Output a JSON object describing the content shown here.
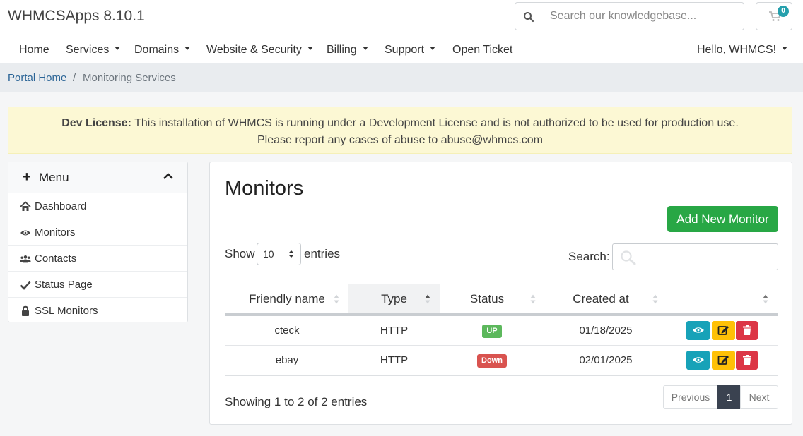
{
  "header": {
    "brand": "WHMCSApps 8.10.1",
    "search_placeholder": "Search our knowledgebase...",
    "cart_count": "0"
  },
  "nav": {
    "items": [
      {
        "label": "Home",
        "dropdown": false
      },
      {
        "label": "Services",
        "dropdown": true
      },
      {
        "label": "Domains",
        "dropdown": true
      },
      {
        "label": "Website & Security",
        "dropdown": true
      },
      {
        "label": "Billing",
        "dropdown": true
      },
      {
        "label": "Support",
        "dropdown": true
      },
      {
        "label": "Open Ticket",
        "dropdown": false
      }
    ],
    "user_menu": "Hello, WHMCS!"
  },
  "breadcrumb": {
    "home": "Portal Home",
    "separator": "/",
    "current": "Monitoring Services"
  },
  "alert": {
    "strong": "Dev License:",
    "line1": "This installation of WHMCS is running under a Development License and is not authorized to be used for production use.",
    "line2": "Please report any cases of abuse to abuse@whmcs.com"
  },
  "sidebar": {
    "title": "Menu",
    "items": [
      {
        "label": "Dashboard",
        "icon": "home-icon"
      },
      {
        "label": "Monitors",
        "icon": "eye-icon"
      },
      {
        "label": "Contacts",
        "icon": "users-icon"
      },
      {
        "label": "Status Page",
        "icon": "check-icon"
      },
      {
        "label": "SSL Monitors",
        "icon": "lock-icon"
      }
    ]
  },
  "main": {
    "title": "Monitors",
    "add_button": "Add New Monitor",
    "show_label": "Show",
    "entries_value": "10",
    "entries_label": "entries",
    "search_label": "Search:",
    "columns": [
      "Friendly name",
      "Type",
      "Status",
      "Created at",
      ""
    ],
    "rows": [
      {
        "name": "cteck",
        "type": "HTTP",
        "status": "UP",
        "status_color": "#5cb85c",
        "created": "01/18/2025"
      },
      {
        "name": "ebay",
        "type": "HTTP",
        "status": "Down",
        "status_color": "#d9534f",
        "created": "02/01/2025"
      }
    ],
    "footer_info": "Showing 1 to 2 of 2 entries",
    "pager": {
      "previous": "Previous",
      "page": "1",
      "next": "Next"
    }
  },
  "colors": {
    "view": "#17a2b8",
    "edit": "#ffc107",
    "delete": "#dc3545",
    "add": "#28a745"
  }
}
